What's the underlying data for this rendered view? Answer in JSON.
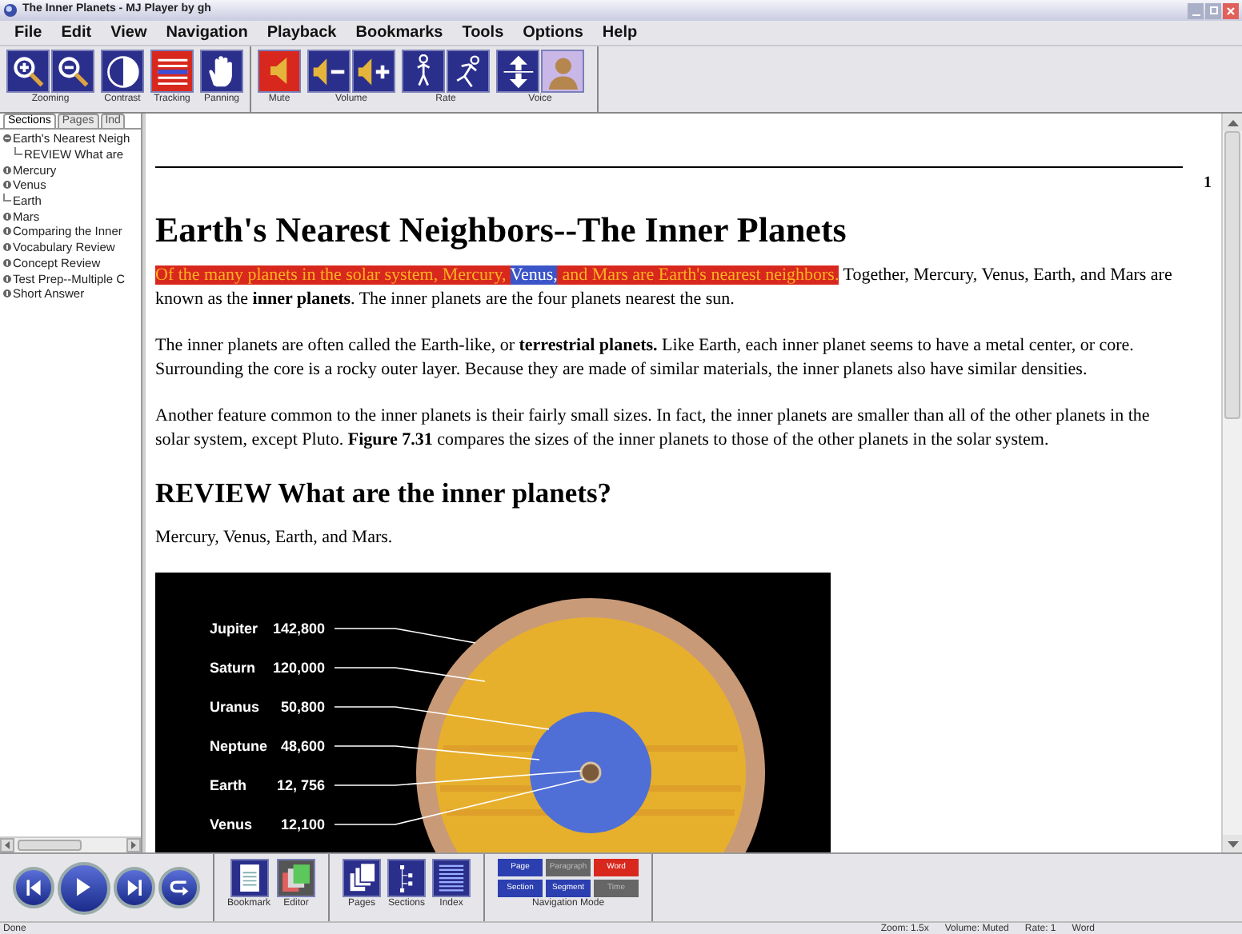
{
  "window": {
    "title": "The Inner Planets - MJ Player by gh"
  },
  "menu": [
    "File",
    "Edit",
    "View",
    "Navigation",
    "Playback",
    "Bookmarks",
    "Tools",
    "Options",
    "Help"
  ],
  "toolbar": [
    [
      {
        "label": "Zooming",
        "buttons": [
          {
            "kind": "zoom-in",
            "active": false
          },
          {
            "kind": "zoom-out",
            "active": false
          }
        ]
      },
      {
        "label": "Contrast",
        "buttons": [
          {
            "kind": "contrast",
            "active": false
          }
        ]
      },
      {
        "label": "Tracking",
        "buttons": [
          {
            "kind": "tracking",
            "active": true
          }
        ]
      },
      {
        "label": "Panning",
        "buttons": [
          {
            "kind": "panning",
            "active": false
          }
        ]
      }
    ],
    [
      {
        "label": "Mute",
        "buttons": [
          {
            "kind": "mute",
            "active": true
          }
        ]
      },
      {
        "label": "Volume",
        "buttons": [
          {
            "kind": "volume-down",
            "active": false
          },
          {
            "kind": "volume-up",
            "active": false
          }
        ]
      },
      {
        "label": "Rate",
        "buttons": [
          {
            "kind": "rate-slow",
            "active": false
          },
          {
            "kind": "rate-fast",
            "active": false
          }
        ]
      },
      {
        "label": "Voice",
        "buttons": [
          {
            "kind": "voice-select",
            "active": false
          },
          {
            "kind": "avatar",
            "active": false
          }
        ]
      }
    ]
  ],
  "sidebar": {
    "tabs": [
      {
        "label": "Sections",
        "selected": true
      },
      {
        "label": "Pages",
        "selected": false
      },
      {
        "label": "Ind",
        "selected": false
      }
    ],
    "tree": [
      {
        "label": "Earth's Nearest Neigh",
        "kind": "branch",
        "expanded": true,
        "children": [
          {
            "label": "REVIEW What are",
            "kind": "leaf"
          }
        ]
      },
      {
        "label": "Mercury",
        "kind": "branch",
        "expanded": false
      },
      {
        "label": "Venus",
        "kind": "branch",
        "expanded": false
      },
      {
        "label": "Earth",
        "kind": "leaf"
      },
      {
        "label": "Mars",
        "kind": "branch",
        "expanded": false
      },
      {
        "label": "Comparing the Inner",
        "kind": "branch",
        "expanded": false
      },
      {
        "label": "Vocabulary Review",
        "kind": "branch",
        "expanded": false
      },
      {
        "label": "Concept Review",
        "kind": "branch",
        "expanded": false
      },
      {
        "label": "Test Prep--Multiple C",
        "kind": "branch",
        "expanded": false
      },
      {
        "label": "Short Answer",
        "kind": "branch",
        "expanded": false
      }
    ]
  },
  "document": {
    "page_number": "1",
    "blocks": [
      {
        "kind": "heading",
        "text": "Earth's Nearest Neighbors--The Inner Planets"
      },
      {
        "kind": "paragraph",
        "segments": [
          {
            "text": "Of the many planets in the solar system, Mercury, ",
            "highlighted": true,
            "current_word": false
          },
          {
            "text": "Venus,",
            "highlighted": true,
            "current_word": true
          },
          {
            "text": " and Mars are Earth's nearest neighbors.",
            "highlighted": true,
            "current_word": false
          },
          {
            "text": " Together, Mercury, Venus, Earth, and Mars are known as the **inner planets**. The inner planets are the four planets nearest the sun.",
            "highlighted": false,
            "current_word": false
          }
        ]
      },
      {
        "kind": "paragraph",
        "segments": [
          {
            "text": "The inner planets are often called the Earth-like, or **terrestrial planets.** Like Earth, each inner planet seems to have a metal center, or core. Surrounding the core is a rocky outer layer. Because they are made of similar materials, the inner planets also have similar densities.",
            "highlighted": false,
            "current_word": false
          }
        ]
      },
      {
        "kind": "paragraph",
        "segments": [
          {
            "text": "Another feature common to the inner planets is their fairly small sizes. In fact, the inner planets are smaller than all of the other planets in the solar system, except Pluto. **Figure 7.31** compares the sizes of the inner planets to those of the other planets in the solar system.",
            "highlighted": false,
            "current_word": false
          }
        ]
      },
      {
        "kind": "subheading",
        "text": "REVIEW What are the inner planets?"
      },
      {
        "kind": "paragraph",
        "segments": [
          {
            "text": "Mercury, Venus, Earth, and Mars.",
            "highlighted": false,
            "current_word": false
          }
        ]
      },
      {
        "kind": "figure",
        "labels": [
          {
            "planet": "Jupiter",
            "value": "142,800"
          },
          {
            "planet": "Saturn",
            "value": "120,000"
          },
          {
            "planet": "Uranus",
            "value": "50,800"
          },
          {
            "planet": "Neptune",
            "value": "48,600"
          },
          {
            "planet": "Earth",
            "value": "12, 756"
          },
          {
            "planet": "Venus",
            "value": "12,100"
          }
        ]
      }
    ]
  },
  "bottom_toolbar": {
    "playback": [
      {
        "kind": "previous"
      },
      {
        "kind": "play"
      },
      {
        "kind": "next"
      },
      {
        "kind": "return"
      }
    ],
    "groups": [
      [
        {
          "label": "Bookmark",
          "kind": "bookmark"
        },
        {
          "label": "Editor",
          "kind": "editor"
        }
      ],
      [
        {
          "label": "Pages",
          "kind": "pages"
        },
        {
          "label": "Sections",
          "kind": "sections"
        },
        {
          "label": "Index",
          "kind": "index"
        }
      ]
    ],
    "navigation_mode": {
      "label": "Navigation Mode",
      "modes": [
        {
          "label": "Page",
          "selected": false,
          "disabled": false
        },
        {
          "label": "Paragraph",
          "selected": false,
          "disabled": true
        },
        {
          "label": "Word",
          "selected": true,
          "disabled": false
        },
        {
          "label": "Section",
          "selected": false,
          "disabled": false
        },
        {
          "label": "Segment",
          "selected": false,
          "disabled": false
        },
        {
          "label": "Time",
          "selected": false,
          "disabled": true
        }
      ]
    }
  },
  "status_bar": {
    "text": "Done",
    "fields": [
      "Zoom: 1.5x",
      "Volume: Muted",
      "Rate: 1",
      "Word"
    ]
  }
}
